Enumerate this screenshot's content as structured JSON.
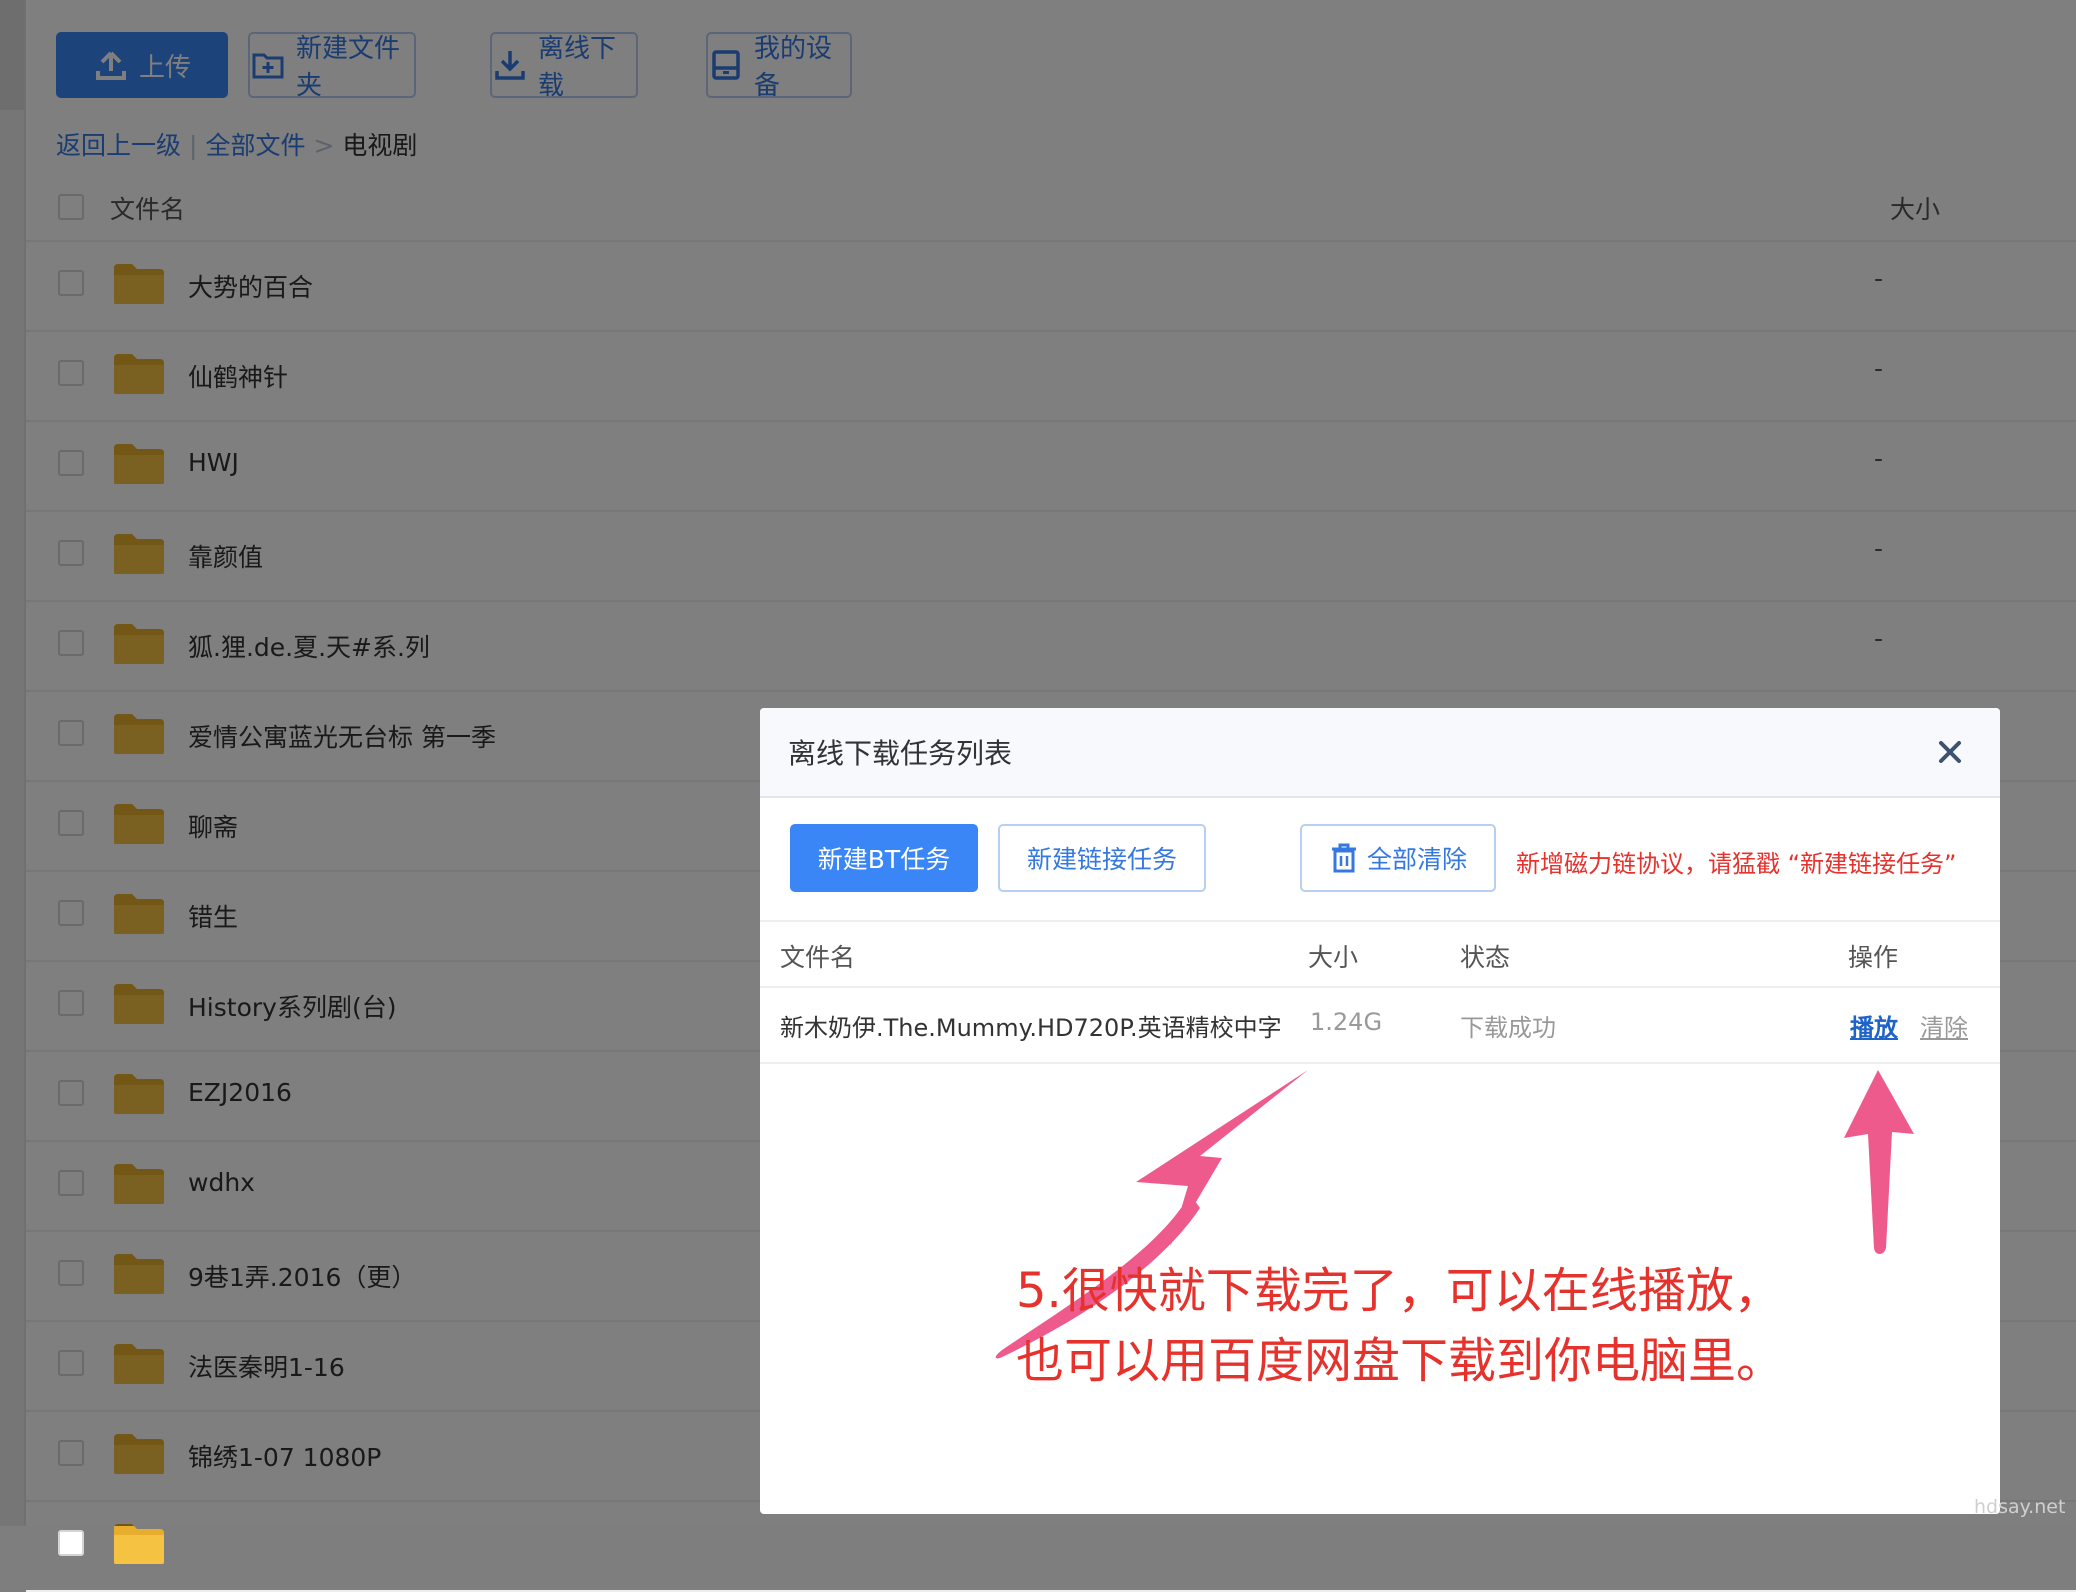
{
  "toolbar": {
    "upload": "上传",
    "new_folder": "新建文件夹",
    "offline_download": "离线下载",
    "my_devices": "我的设备"
  },
  "breadcrumb": {
    "back": "返回上一级",
    "sep1": "|",
    "all_files": "全部文件",
    "sep2": ">",
    "current": "电视剧"
  },
  "file_list": {
    "columns": {
      "name": "文件名",
      "size": "大小"
    },
    "rows": [
      {
        "name": "大势的百合",
        "size": "-"
      },
      {
        "name": "仙鹤神针",
        "size": "-"
      },
      {
        "name": "HWJ",
        "size": "-"
      },
      {
        "name": "靠颜值",
        "size": "-"
      },
      {
        "name": "狐.狸.de.夏.天#系.列",
        "size": "-"
      },
      {
        "name": "爱情公寓蓝光无台标 第一季",
        "size": ""
      },
      {
        "name": "聊斋",
        "size": ""
      },
      {
        "name": "错生",
        "size": ""
      },
      {
        "name": "History系列剧(台)",
        "size": ""
      },
      {
        "name": "EZJ2016",
        "size": ""
      },
      {
        "name": "wdhx",
        "size": ""
      },
      {
        "name": "9巷1弄.2016（更）",
        "size": ""
      },
      {
        "name": "法医秦明1-16",
        "size": ""
      },
      {
        "name": "锦绣1-07 1080P",
        "size": ""
      },
      {
        "name": "",
        "size": ""
      }
    ]
  },
  "modal": {
    "title": "离线下载任务列表",
    "new_bt": "新建BT任务",
    "new_link": "新建链接任务",
    "clear_all": "全部清除",
    "notice": "新增磁力链协议，请猛戳 “新建链接任务”",
    "columns": {
      "name": "文件名",
      "size": "大小",
      "status": "状态",
      "action": "操作"
    },
    "task": {
      "name": "新木奶伊.The.Mummy.HD720P.英语精校中字",
      "size": "1.24G",
      "status": "下载成功",
      "play": "播放",
      "clear": "清除"
    },
    "annotation_line1": "5.很快就下载完了，可以在线播放，",
    "annotation_line2": "也可以用百度网盘下载到你电脑里。"
  },
  "watermark": "hdsay.net",
  "colors": {
    "accent": "#3a86f6",
    "link": "#3478e0",
    "annotation": "#e5322d",
    "arrow": "#ee5a8c",
    "folder": "#f5c242"
  }
}
